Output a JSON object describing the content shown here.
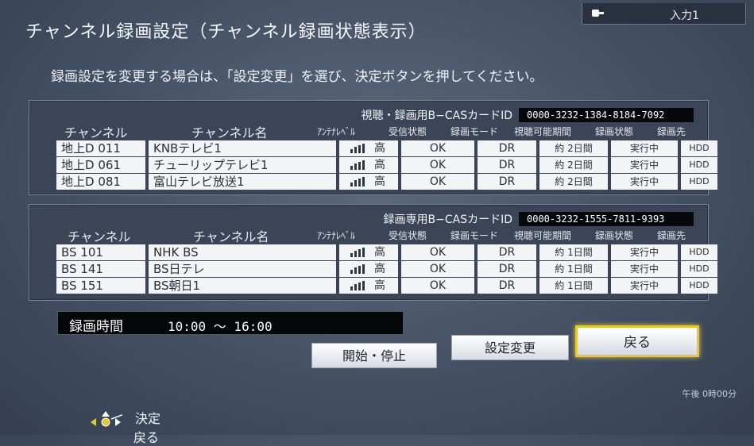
{
  "input_tab": {
    "label": "入力1"
  },
  "page": {
    "title": "チャンネル録画設定（チャンネル録画状態表示）",
    "instruction": "録画設定を変更する場合は、「設定変更」を選び、決定ボタンを押してください。"
  },
  "columns": {
    "channel": "チャンネル",
    "name": "チャンネル名",
    "antenna": "ｱﾝﾃﾅﾚﾍﾞﾙ",
    "reception": "受信状態",
    "mode": "録画モード",
    "period": "視聴可能期間",
    "state": "録画状態",
    "dest": "録画先"
  },
  "panel1": {
    "cas_label": "視聴・録画用B−CASカードID",
    "cas_id": "0000-3232-1384-8184-7092",
    "rows": [
      {
        "channel": "地上D 011",
        "name": "KNBテレビ1",
        "level": "高",
        "reception": "OK",
        "mode": "DR",
        "period": "約 2日間",
        "state": "実行中",
        "dest": "HDD"
      },
      {
        "channel": "地上D 061",
        "name": "チューリップテレビ1",
        "level": "高",
        "reception": "OK",
        "mode": "DR",
        "period": "約 2日間",
        "state": "実行中",
        "dest": "HDD"
      },
      {
        "channel": "地上D 081",
        "name": "富山テレビ放送1",
        "level": "高",
        "reception": "OK",
        "mode": "DR",
        "period": "約 2日間",
        "state": "実行中",
        "dest": "HDD"
      }
    ]
  },
  "panel2": {
    "cas_label": "録画専用B−CASカードID",
    "cas_id": "0000-3232-1555-7811-9393",
    "rows": [
      {
        "channel": "BS 101",
        "name": "NHK  BS",
        "level": "高",
        "reception": "OK",
        "mode": "DR",
        "period": "約 1日間",
        "state": "実行中",
        "dest": "HDD"
      },
      {
        "channel": "BS 141",
        "name": "BS日テレ",
        "level": "高",
        "reception": "OK",
        "mode": "DR",
        "period": "約 1日間",
        "state": "実行中",
        "dest": "HDD"
      },
      {
        "channel": "BS 151",
        "name": "BS朝日1",
        "level": "高",
        "reception": "OK",
        "mode": "DR",
        "period": "約 1日間",
        "state": "実行中",
        "dest": "HDD"
      }
    ]
  },
  "recording_time": {
    "label": "録画時間",
    "value": "10:00 〜 16:00"
  },
  "buttons": {
    "start_stop": "開始・停止",
    "settings_change": "設定変更",
    "back": "戻る"
  },
  "clock": "午後 0時00分",
  "legend": {
    "decide": "決定",
    "back": "戻る"
  },
  "colors": {
    "focus": "#e3c93a",
    "background": "#445064"
  }
}
